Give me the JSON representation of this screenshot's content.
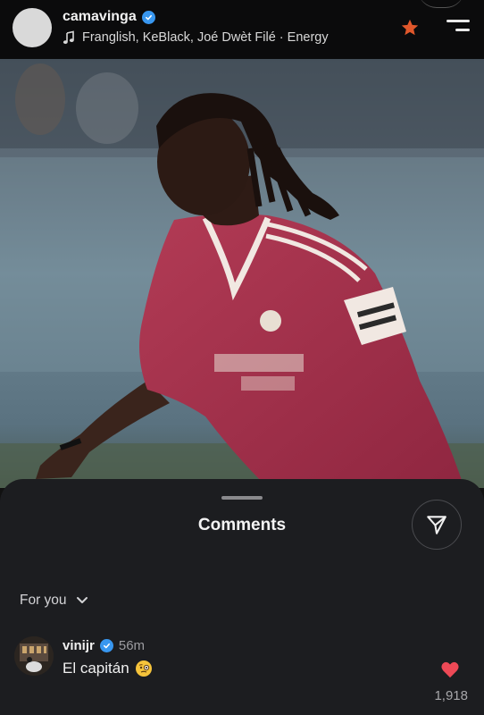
{
  "header": {
    "username": "camavinga",
    "music": "Franglish, KeBlack, Joé Dwèt Filé · Energy",
    "icons": {
      "verified": "verified-badge-icon",
      "music": "music-note-icon",
      "star": "star-icon",
      "menu": "menu-icon"
    },
    "star_color": "#e0572b"
  },
  "comments_sheet": {
    "title": "Comments",
    "filter_label": "For you",
    "share_icon": "send-icon",
    "comment": {
      "username": "vinijr",
      "time": "56m",
      "text": "El capitán",
      "emoji": "face-with-monocle-emoji",
      "likes": "1,918",
      "like_icon": "heart-filled-icon",
      "like_color": "#ed4956"
    }
  },
  "colors": {
    "verified": "#3897f0",
    "sheet_bg": "#1c1d20",
    "header_bg": "#0b0b0c"
  }
}
